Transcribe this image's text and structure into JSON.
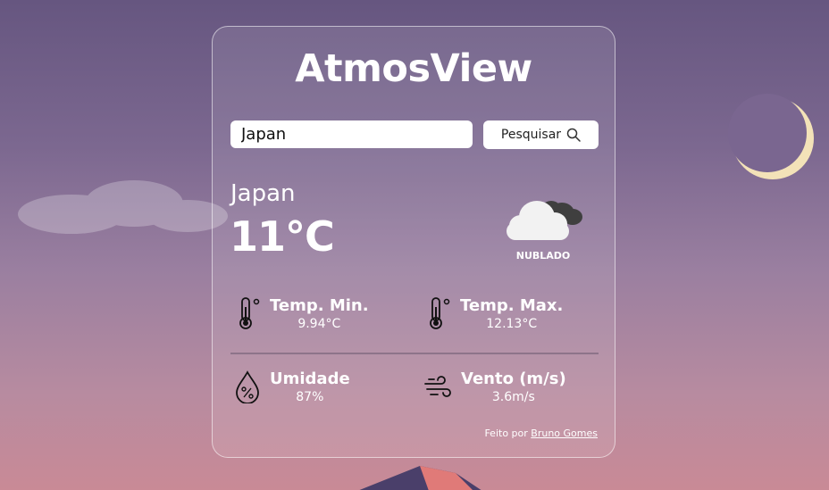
{
  "app": {
    "title": "AtmosView"
  },
  "search": {
    "value": "Japan",
    "button_label": "Pesquisar",
    "icon": "search-icon"
  },
  "weather": {
    "city": "Japan",
    "temperature": "11°C",
    "description": "NUBLADO",
    "icon": "cloudy-icon"
  },
  "stats": {
    "min": {
      "label": "Temp. Min.",
      "value": "9.94°C",
      "icon": "thermometer-icon"
    },
    "max": {
      "label": "Temp. Max.",
      "value": "12.13°C",
      "icon": "thermometer-icon"
    },
    "humidity": {
      "label": "Umidade",
      "value": "87%",
      "icon": "humidity-drop-icon"
    },
    "wind": {
      "label": "Vento (m/s)",
      "value": "3.6m/s",
      "icon": "wind-icon"
    }
  },
  "footer": {
    "prefix": "Feito por",
    "author": "Bruno Gomes"
  },
  "colors": {
    "card_border": "#e6dbe8",
    "background_top": "#665680",
    "background_bottom": "#c98a96",
    "moon": "#f3e2b8"
  }
}
